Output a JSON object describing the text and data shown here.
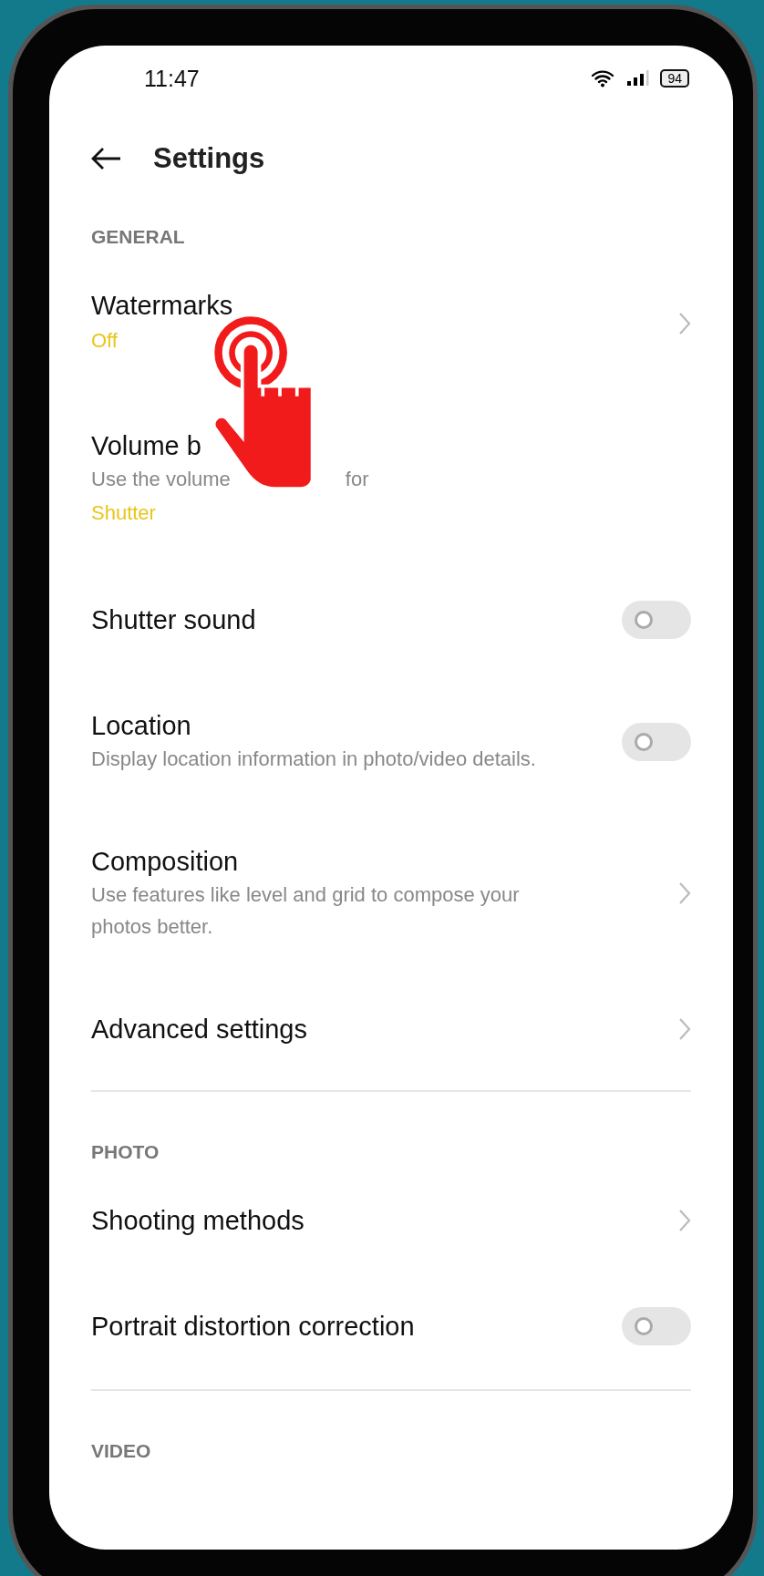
{
  "status_bar": {
    "time": "11:47",
    "battery": "94"
  },
  "header": {
    "title": "Settings"
  },
  "sections": [
    {
      "heading": "GENERAL",
      "items": [
        {
          "kind": "link",
          "title": "Watermarks",
          "value": "Off"
        },
        {
          "kind": "link-covered",
          "title": "Volume b",
          "description_parts": [
            "Use the volume",
            "for"
          ],
          "value": "Shutter"
        },
        {
          "kind": "toggle",
          "title": "Shutter sound",
          "on": false
        },
        {
          "kind": "toggle",
          "title": "Location",
          "description": "Display location information in photo/video details.",
          "on": false
        },
        {
          "kind": "link",
          "title": "Composition",
          "description": "Use features like level and grid to compose your photos better."
        },
        {
          "kind": "link",
          "title": "Advanced settings"
        }
      ]
    },
    {
      "heading": "PHOTO",
      "items": [
        {
          "kind": "link",
          "title": "Shooting methods"
        },
        {
          "kind": "toggle",
          "title": "Portrait distortion correction",
          "on": false
        }
      ]
    },
    {
      "heading": "VIDEO"
    }
  ]
}
